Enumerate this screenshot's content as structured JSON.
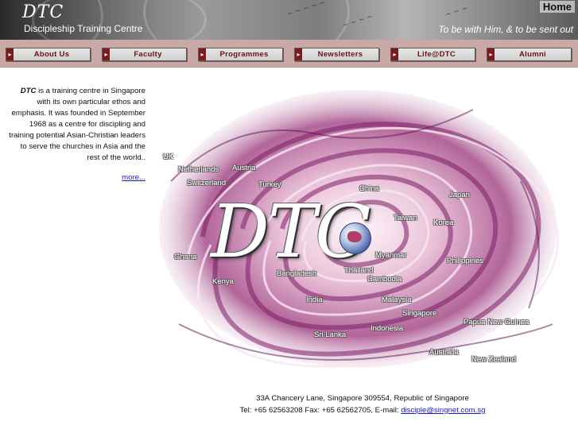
{
  "header": {
    "logo": "DTC",
    "subtitle": "Discipleship Training Centre",
    "home_link": "Home",
    "tagline": "To be with Him, & to be sent out"
  },
  "nav": {
    "items": [
      {
        "label": "About Us"
      },
      {
        "label": "Faculty"
      },
      {
        "label": "Programmes"
      },
      {
        "label": "Newsletters"
      },
      {
        "label": "Life@DTC"
      },
      {
        "label": "Alumni"
      }
    ]
  },
  "intro": {
    "name": "DTC",
    "text": " is a training centre in Singapore with its own particular ethos and emphasis. It was founded in September 1968 as a centre for discipling and training potential Asian-Christian leaders to serve the churches in Asia and the rest of the world..",
    "more_link": "more..."
  },
  "graphic": {
    "wordmark": "DTC",
    "countries": [
      {
        "name": "UK"
      },
      {
        "name": "Netherlands"
      },
      {
        "name": "Austria"
      },
      {
        "name": "Switzerland"
      },
      {
        "name": "Turkey"
      },
      {
        "name": "China"
      },
      {
        "name": "Japan"
      },
      {
        "name": "Taiwan"
      },
      {
        "name": "Korea"
      },
      {
        "name": "Myanmar"
      },
      {
        "name": "Philippines"
      },
      {
        "name": "Ghana"
      },
      {
        "name": "Bangladesh"
      },
      {
        "name": "Thailand"
      },
      {
        "name": "Cambodia"
      },
      {
        "name": "Kenya"
      },
      {
        "name": "India"
      },
      {
        "name": "Malaysia"
      },
      {
        "name": "Singapore"
      },
      {
        "name": "Papua New Guinea"
      },
      {
        "name": "Sri Lanka"
      },
      {
        "name": "Indonesia"
      },
      {
        "name": "Australia"
      },
      {
        "name": "New Zealand"
      }
    ]
  },
  "footer": {
    "address": "33A Chancery Lane, Singapore 309554, Republic of Singapore",
    "contact_prefix": "Tel: +65 62563208 Fax: +65 62562705, E-mail: ",
    "email": "disciple@singnet.com.sg"
  },
  "colors": {
    "nav_bg": "#c9a9a6",
    "nav_text": "#6a1010",
    "link": "#1a1acc",
    "swirl": "#9b3a7e"
  }
}
